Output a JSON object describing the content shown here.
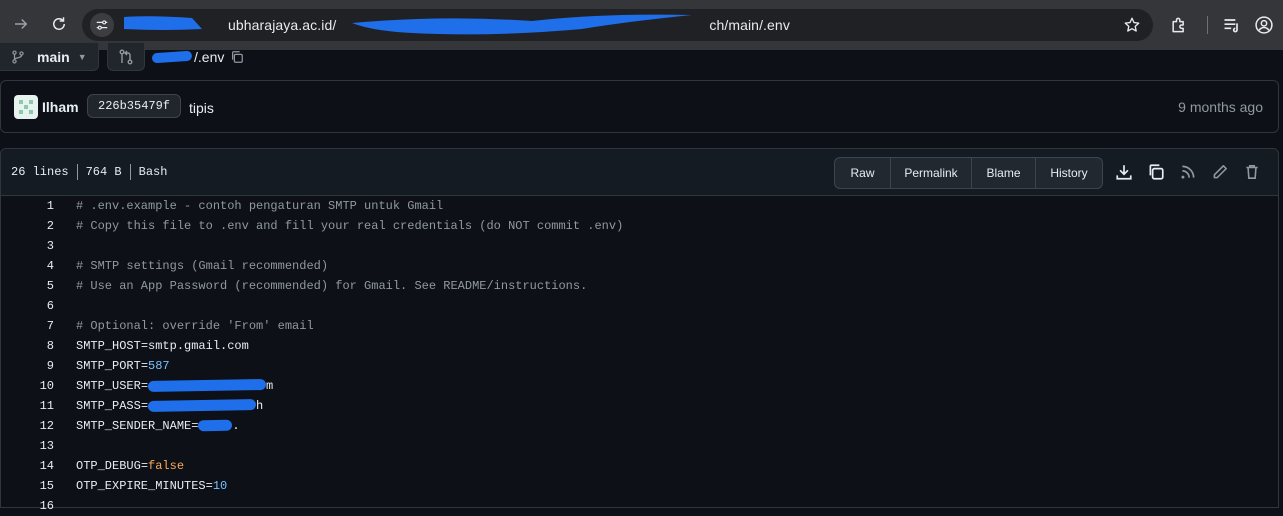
{
  "browser": {
    "url_prefix": "",
    "url_host": "ubharajaya.ac.id",
    "url_mid": "/",
    "url_tail": "ch/main/.env",
    "accent": "#1f6feb"
  },
  "repo": {
    "branch": "main",
    "path_suffix": "/.env"
  },
  "commit": {
    "author": "Ilham",
    "sha": "226b35479f",
    "message": "tipis",
    "time": "9 months ago"
  },
  "file": {
    "lines_count": "26 lines",
    "size": "764 B",
    "language": "Bash",
    "buttons": [
      "Raw",
      "Permalink",
      "Blame",
      "History"
    ]
  },
  "code_lines": [
    {
      "n": "1",
      "text": "# .env.example - contoh pengaturan SMTP untuk Gmail"
    },
    {
      "n": "2",
      "text": "# Copy this file to .env and fill your real credentials (do NOT commit .env)"
    },
    {
      "n": "3",
      "text": ""
    },
    {
      "n": "4",
      "text": "# SMTP settings (Gmail recommended)"
    },
    {
      "n": "5",
      "text": "# Use an App Password (recommended) for Gmail. See README/instructions."
    },
    {
      "n": "6",
      "text": ""
    },
    {
      "n": "7",
      "text": "# Optional: override 'From' email"
    },
    {
      "n": "8",
      "key": "SMTP_HOST",
      "value": "smtp.gmail.com",
      "vtype": "str"
    },
    {
      "n": "9",
      "key": "SMTP_PORT",
      "value": "587",
      "vtype": "num"
    },
    {
      "n": "10",
      "key": "SMTP_USER",
      "value": "m",
      "vtype": "str"
    },
    {
      "n": "11",
      "key": "SMTP_PASS",
      "value": "h",
      "vtype": "str"
    },
    {
      "n": "12",
      "key": "SMTP_SENDER_NAME",
      "value": ".",
      "vtype": "str"
    },
    {
      "n": "13",
      "text": ""
    },
    {
      "n": "14",
      "key": "OTP_DEBUG",
      "value": "false",
      "vtype": "kw"
    },
    {
      "n": "15",
      "key": "OTP_EXPIRE_MINUTES",
      "value": "10",
      "vtype": "num"
    },
    {
      "n": "16",
      "text": ""
    }
  ],
  "icons": {
    "forward": "arrow-right-icon",
    "reload": "reload-icon",
    "site_info": "tune-icon",
    "bookmark": "star-icon",
    "extensions": "puzzle-icon",
    "queue": "playlist-icon",
    "profile": "profile-icon",
    "branch": "git-branch-icon",
    "compare": "git-compare-icon",
    "copy": "copy-icon",
    "download": "download-icon",
    "rss": "rss-icon",
    "edit": "pencil-icon",
    "delete": "trash-icon"
  }
}
